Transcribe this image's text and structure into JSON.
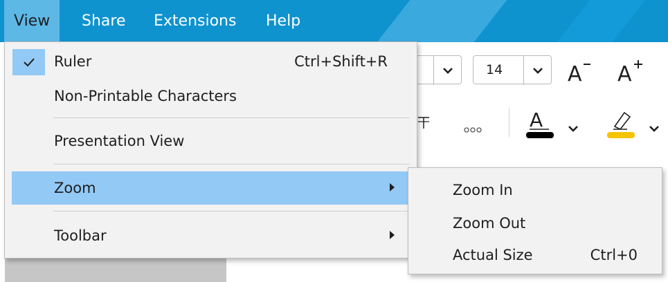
{
  "menubar": {
    "items": [
      {
        "label": "View"
      },
      {
        "label": "Share"
      },
      {
        "label": "Extensions"
      },
      {
        "label": "Help"
      }
    ]
  },
  "toolbar": {
    "font_size_value": "14",
    "icons": [
      "chevron-down-icon",
      "decrease-font-size-icon",
      "increase-font-size-icon",
      "strikethrough-icon",
      "more-icon",
      "font-color-icon",
      "highlight-icon"
    ],
    "font_color": "#000000",
    "highlight_color": "#f5c400"
  },
  "view_menu": {
    "items": [
      {
        "label": "Ruler",
        "shortcut": "Ctrl+Shift+R",
        "checked": true
      },
      {
        "label": "Non-Printable Characters"
      },
      {
        "label": "Presentation View"
      },
      {
        "label": "Zoom",
        "has_submenu": true,
        "highlighted": true
      },
      {
        "label": "Toolbar",
        "has_submenu": true
      }
    ]
  },
  "zoom_submenu": {
    "items": [
      {
        "label": "Zoom In"
      },
      {
        "label": "Zoom Out"
      },
      {
        "label": "Actual Size",
        "shortcut": "Ctrl+0"
      }
    ]
  },
  "colors": {
    "menubar": "#0e93cf",
    "menu_bg": "#f2f2f2",
    "highlight": "#93c9f5"
  }
}
